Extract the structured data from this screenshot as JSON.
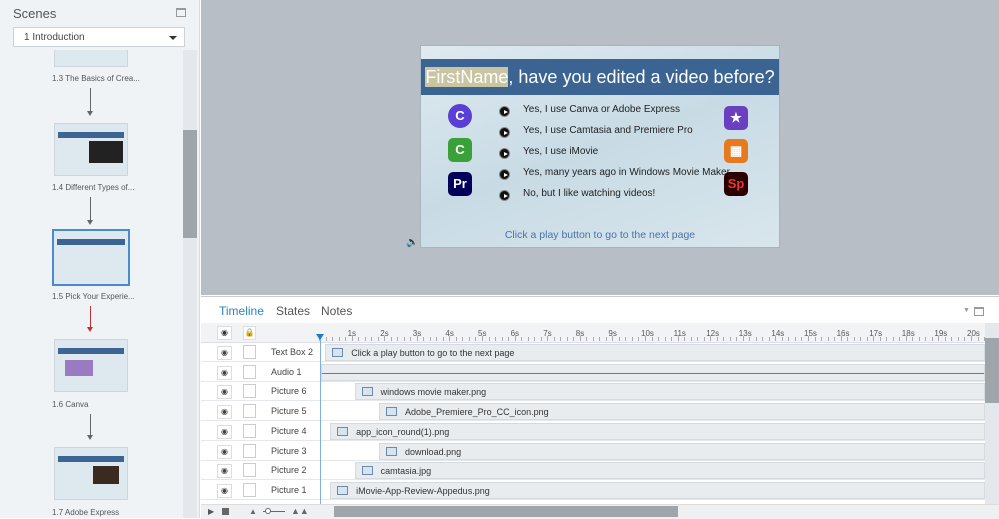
{
  "scenes_panel": {
    "title": "Scenes",
    "selected_scene": "1 Introduction",
    "slides": [
      {
        "label": "1.3 The Basics of Crea..."
      },
      {
        "label": "1.4 Different Types of..."
      },
      {
        "label": "1.5 Pick Your Experie..."
      },
      {
        "label": "1.6 Canva"
      },
      {
        "label": "1.7 Adobe Express"
      }
    ]
  },
  "slide": {
    "name_var": "FirstName",
    "title_rest": ", have you edited a video before?",
    "options": [
      "Yes, I use Canva or Adobe Express",
      "Yes, I use Camtasia and Premiere Pro",
      "Yes, I use iMovie",
      "Yes, many years ago in Windows Movie Maker.",
      "No, but I like watching videos!"
    ],
    "icons_left": [
      {
        "name": "canva",
        "text": "C",
        "color": "#5a3fd6"
      },
      {
        "name": "camtasia",
        "text": "C",
        "color": "#3aa13a"
      },
      {
        "name": "premiere",
        "text": "Pr",
        "color": "#00005b"
      }
    ],
    "icons_right": [
      {
        "name": "imovie",
        "text": "★",
        "color": "#6a3fc0"
      },
      {
        "name": "windows-movie-maker",
        "text": "▦",
        "color": "#e77a1e"
      },
      {
        "name": "adobe-spark",
        "text": "Sp",
        "color": "#2b0000"
      }
    ],
    "footer": "Click a play button to go to the next page"
  },
  "bottom": {
    "tabs": [
      "Timeline",
      "States",
      "Notes"
    ],
    "active_tab": "Timeline",
    "ticks": [
      "1s",
      "2s",
      "3s",
      "4s",
      "5s",
      "6s",
      "7s",
      "8s",
      "9s",
      "10s",
      "11s",
      "12s",
      "13s",
      "14s",
      "15s",
      "16s",
      "17s",
      "18s",
      "19s",
      "20s"
    ],
    "rows": [
      {
        "name": "Text Box 2",
        "type": "text",
        "label": "Click a play button to go to the next page",
        "start_s": 0.1
      },
      {
        "name": "Audio 1",
        "type": "audio",
        "label": "",
        "start_s": 0
      },
      {
        "name": "Picture 6",
        "type": "image",
        "label": "windows movie maker.png",
        "start_s": 1.0
      },
      {
        "name": "Picture 5",
        "type": "image",
        "label": "Adobe_Premiere_Pro_CC_icon.png",
        "start_s": 1.75
      },
      {
        "name": "Picture 4",
        "type": "image",
        "label": "app_icon_round(1).png",
        "start_s": 0.25
      },
      {
        "name": "Picture 3",
        "type": "image",
        "label": "download.png",
        "start_s": 1.75
      },
      {
        "name": "Picture 2",
        "type": "image",
        "label": "camtasia.jpg",
        "start_s": 1.0
      },
      {
        "name": "Picture 1",
        "type": "image",
        "label": "iMovie-App-Review-Appedus.png",
        "start_s": 0.25
      }
    ]
  }
}
